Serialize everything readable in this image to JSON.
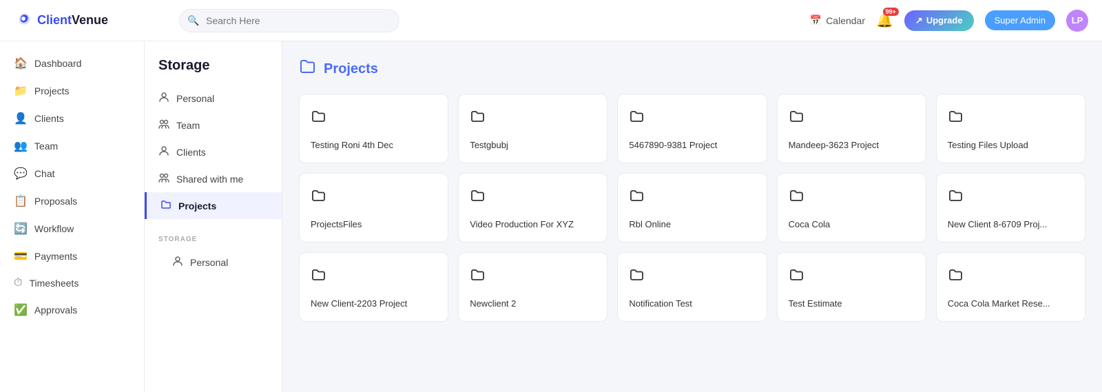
{
  "app": {
    "name_part1": "Client",
    "name_part2": "Venue"
  },
  "header": {
    "search_placeholder": "Search Here",
    "calendar_label": "Calendar",
    "notification_badge": "99+",
    "upgrade_label": "Upgrade",
    "super_admin_label": "Super Admin",
    "avatar_initials": "LP"
  },
  "sidebar": {
    "items": [
      {
        "id": "dashboard",
        "label": "Dashboard",
        "icon": "🏠"
      },
      {
        "id": "projects",
        "label": "Projects",
        "icon": "📁"
      },
      {
        "id": "clients",
        "label": "Clients",
        "icon": "👤"
      },
      {
        "id": "team",
        "label": "Team",
        "icon": "👥"
      },
      {
        "id": "chat",
        "label": "Chat",
        "icon": "💬"
      },
      {
        "id": "proposals",
        "label": "Proposals",
        "icon": "📋"
      },
      {
        "id": "workflow",
        "label": "Workflow",
        "icon": "🔄"
      },
      {
        "id": "payments",
        "label": "Payments",
        "icon": "💳"
      },
      {
        "id": "timesheets",
        "label": "Timesheets",
        "icon": "⏱"
      },
      {
        "id": "approvals",
        "label": "Approvals",
        "icon": "✅"
      }
    ]
  },
  "storage": {
    "title": "Storage",
    "items": [
      {
        "id": "personal",
        "label": "Personal",
        "icon": "👤"
      },
      {
        "id": "team",
        "label": "Team",
        "icon": "👥"
      },
      {
        "id": "clients",
        "label": "Clients",
        "icon": "👤"
      },
      {
        "id": "shared",
        "label": "Shared with me",
        "icon": "👥"
      },
      {
        "id": "projects",
        "label": "Projects",
        "icon": "📁",
        "active": true
      }
    ],
    "bottom_section_title": "STORAGE",
    "bottom_items": [
      {
        "id": "personal2",
        "label": "Personal",
        "icon": "👤"
      }
    ]
  },
  "projects_section": {
    "title": "Projects",
    "cards": [
      {
        "id": "card1",
        "name": "Testing Roni 4th Dec"
      },
      {
        "id": "card2",
        "name": "Testgbubj"
      },
      {
        "id": "card3",
        "name": "5467890-9381 Project"
      },
      {
        "id": "card4",
        "name": "Mandeep-3623 Project"
      },
      {
        "id": "card5",
        "name": "Testing Files Upload"
      },
      {
        "id": "card6",
        "name": "ProjectsFiles"
      },
      {
        "id": "card7",
        "name": "Video Production For XYZ"
      },
      {
        "id": "card8",
        "name": "Rbl Online"
      },
      {
        "id": "card9",
        "name": "Coca Cola"
      },
      {
        "id": "card10",
        "name": "New Client 8-6709 Proj..."
      },
      {
        "id": "card11",
        "name": "New Client-2203 Project"
      },
      {
        "id": "card12",
        "name": "Newclient 2"
      },
      {
        "id": "card13",
        "name": "Notification Test"
      },
      {
        "id": "card14",
        "name": "Test Estimate"
      },
      {
        "id": "card15",
        "name": "Coca Cola Market Rese..."
      }
    ]
  }
}
